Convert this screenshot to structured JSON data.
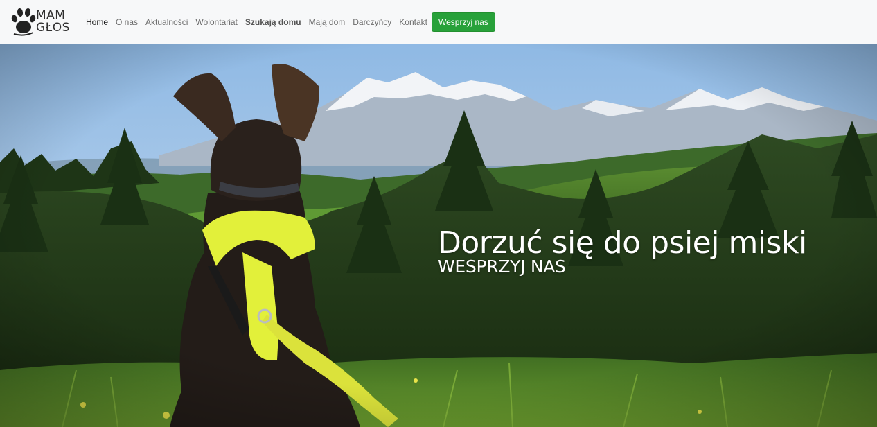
{
  "brand": {
    "name_line1": "MAM",
    "name_line2": "GŁOS",
    "logo_icon": "paw-icon"
  },
  "nav": {
    "items": [
      {
        "label": "Home"
      },
      {
        "label": "O nas"
      },
      {
        "label": "Aktualności"
      },
      {
        "label": "Wolontariat"
      },
      {
        "label": "Szukają domu"
      },
      {
        "label": "Mają dom"
      },
      {
        "label": "Darczyńcy"
      },
      {
        "label": "Kontakt"
      }
    ],
    "cta_label": "Wesprzyj nas",
    "active_item": "Home"
  },
  "hero": {
    "title": "Dorzuć się do psiej miski",
    "subtitle": "WESPRZYJ NAS",
    "image_icon": "dog-mountains-photo"
  },
  "colors": {
    "cta_green": "#28a13a",
    "navbar_bg": "#f7f8f9",
    "sky": "#a7c9ea",
    "harness_yellow": "#e2f03a"
  }
}
